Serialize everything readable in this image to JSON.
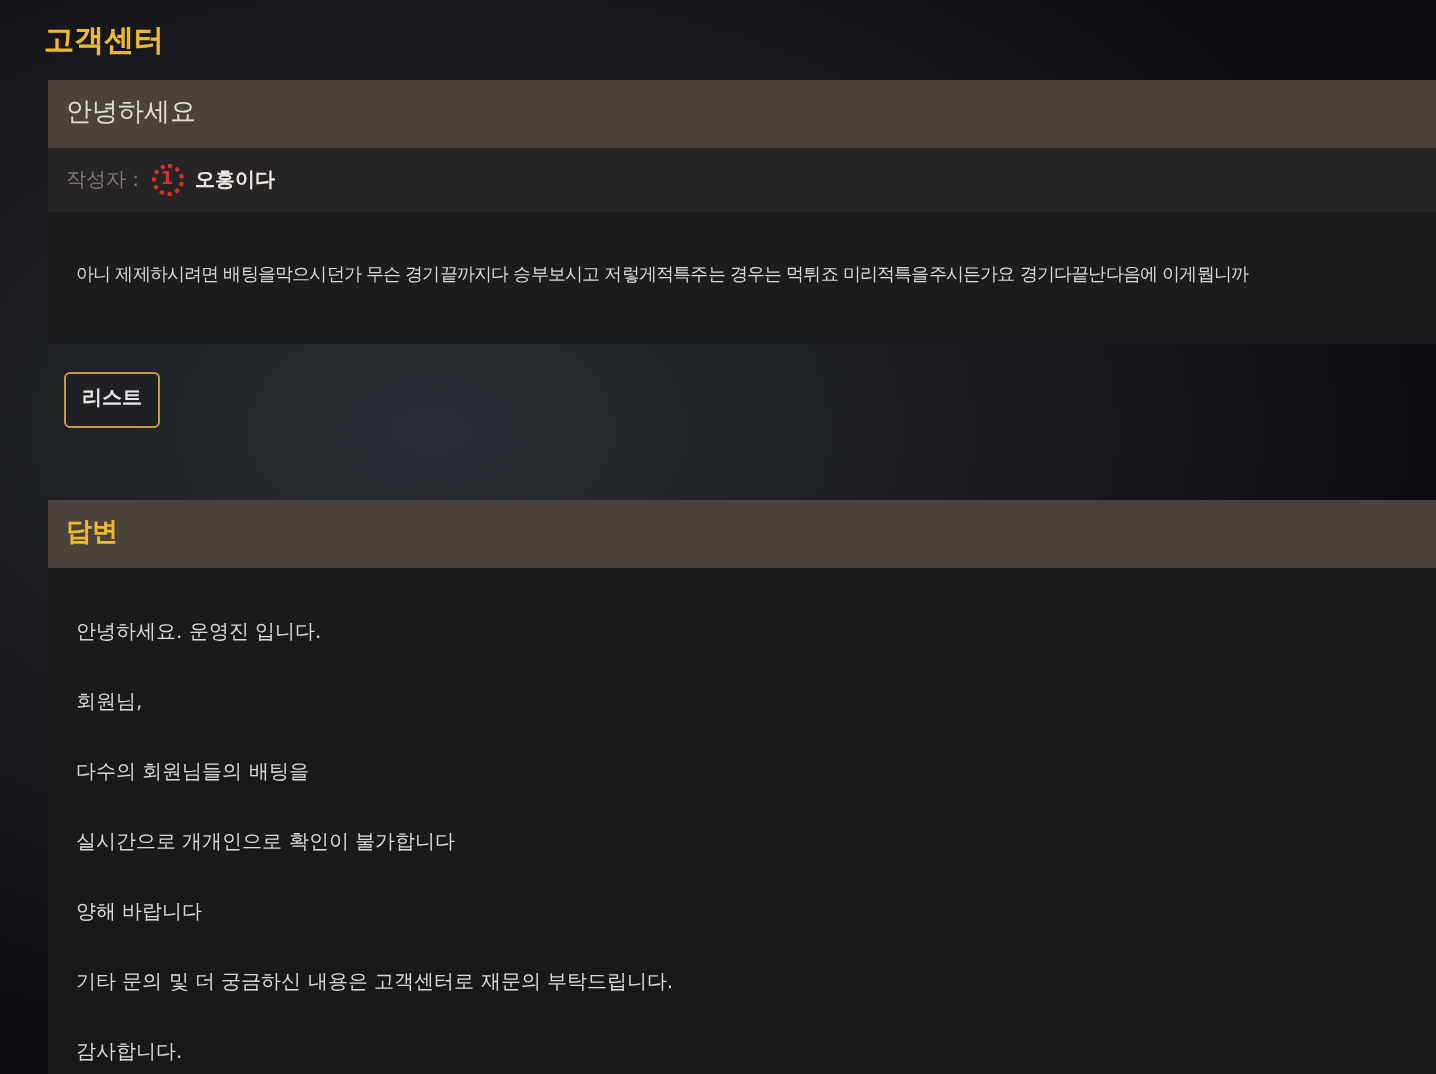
{
  "page_title": "고객센터",
  "post": {
    "title": "안녕하세요",
    "author_label": "작성자 :",
    "author_level": "1",
    "author_name": "오홍이다",
    "body": "아니 제제하시려면 배팅을막으시던가 무슨 경기끝까지다 승부보시고 저렇게적특주는 경우는 먹튀죠 미리적특을주시든가요 경기다끝난다음에 이게뭡니까"
  },
  "list_button": "리스트",
  "answer": {
    "title": "답변",
    "lines": [
      "안녕하세요. 운영진 입니다.",
      "회원님,",
      "다수의 회원님들의 배팅을",
      "실시간으로 개개인으로 확인이 불가합니다",
      "양해 바랍니다",
      "기타 문의 및 더 궁금하신 내용은 고객센터로 재문의 부탁드립니다.",
      "감사합니다."
    ]
  }
}
